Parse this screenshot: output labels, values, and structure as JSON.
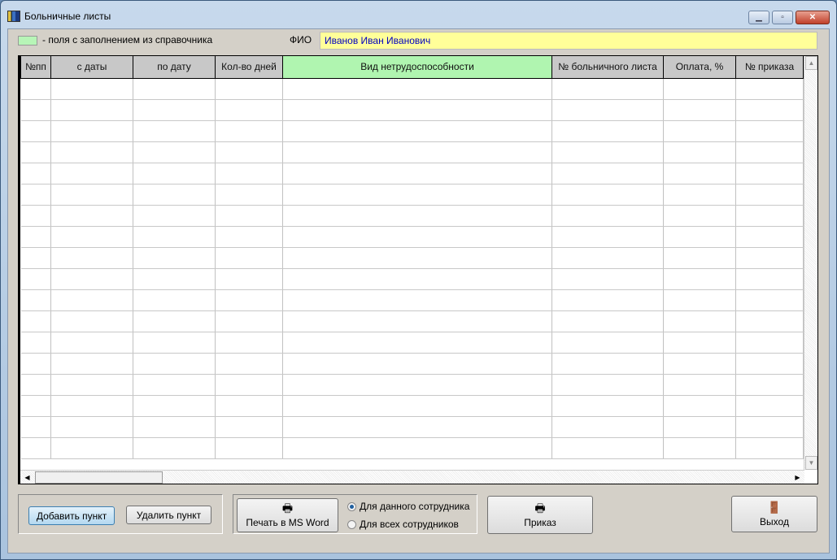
{
  "window": {
    "title": "Больничные листы"
  },
  "legend": {
    "text": "- поля с заполнением из справочника",
    "color": "#b7f5b7"
  },
  "fio": {
    "label": "ФИО",
    "value": "Иванов Иван Иванович"
  },
  "table": {
    "columns": [
      "№пп",
      "с даты",
      "по дату",
      "Кол-во дней",
      "Вид нетрудоспособности",
      "№ больничного листа",
      "Оплата, %",
      "№ приказа"
    ],
    "rows": []
  },
  "buttons": {
    "add": "Добавить пункт",
    "delete": "Удалить пункт",
    "print_word": "Печать в MS Word",
    "order": "Приказ",
    "exit": "Выход"
  },
  "radio": {
    "this_employee": "Для данного сотрудника",
    "all_employees": "Для всех сотрудников",
    "selected": "this_employee"
  }
}
